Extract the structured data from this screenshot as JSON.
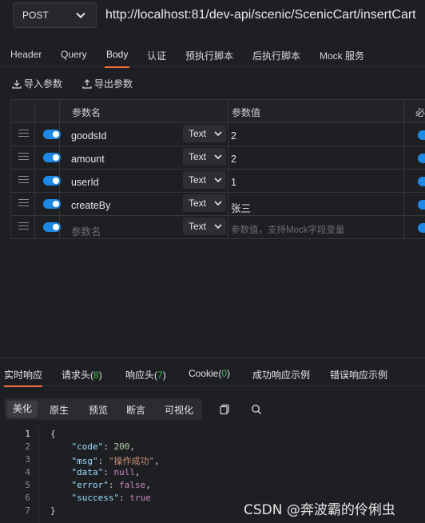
{
  "request": {
    "method": "POST",
    "url": "http://localhost:81/dev-api/scenic/ScenicCart/insertCart"
  },
  "tabs": [
    "Header",
    "Query",
    "Body",
    "认证",
    "预执行脚本",
    "后执行脚本",
    "Mock 服务"
  ],
  "active_tab": "Body",
  "body_actions": {
    "import": "导入参数",
    "export": "导出参数"
  },
  "params_table": {
    "headers": {
      "name": "参数名",
      "value": "参数值",
      "required": "必"
    },
    "rows": [
      {
        "name": "goodsId",
        "type": "Text",
        "value": "2",
        "enabled": true
      },
      {
        "name": "amount",
        "type": "Text",
        "value": "2",
        "enabled": true
      },
      {
        "name": "userId",
        "type": "Text",
        "value": "1",
        "enabled": true
      },
      {
        "name": "createBy",
        "type": "Text",
        "value": "张三",
        "enabled": true
      }
    ],
    "placeholder_row": {
      "name_placeholder": "参数名",
      "type": "Text",
      "value_placeholder": "参数值，支持Mock字段变量"
    }
  },
  "response_tabs": [
    {
      "label": "实时响应"
    },
    {
      "label": "请求头(",
      "count": "8",
      "suffix": ")"
    },
    {
      "label": "响应头(",
      "count": "7",
      "suffix": ")"
    },
    {
      "label": "Cookie(",
      "count": "0",
      "suffix": ")"
    },
    {
      "label": "成功响应示例"
    },
    {
      "label": "错误响应示例"
    }
  ],
  "view_tabs": [
    "美化",
    "原生",
    "预览",
    "断言",
    "可视化"
  ],
  "active_view": "美化",
  "response_body": {
    "line_numbers": [
      "1",
      "2",
      "3",
      "4",
      "5",
      "6",
      "7"
    ],
    "code": "200",
    "msg": "\"操作成功\"",
    "data": "null",
    "error": "false",
    "success": "true"
  },
  "watermark": "CSDN @奔波霸的伶俐虫",
  "colors": {
    "accent": "#f56c3c",
    "toggle": "#1e88e5",
    "count": "#3fb950"
  }
}
